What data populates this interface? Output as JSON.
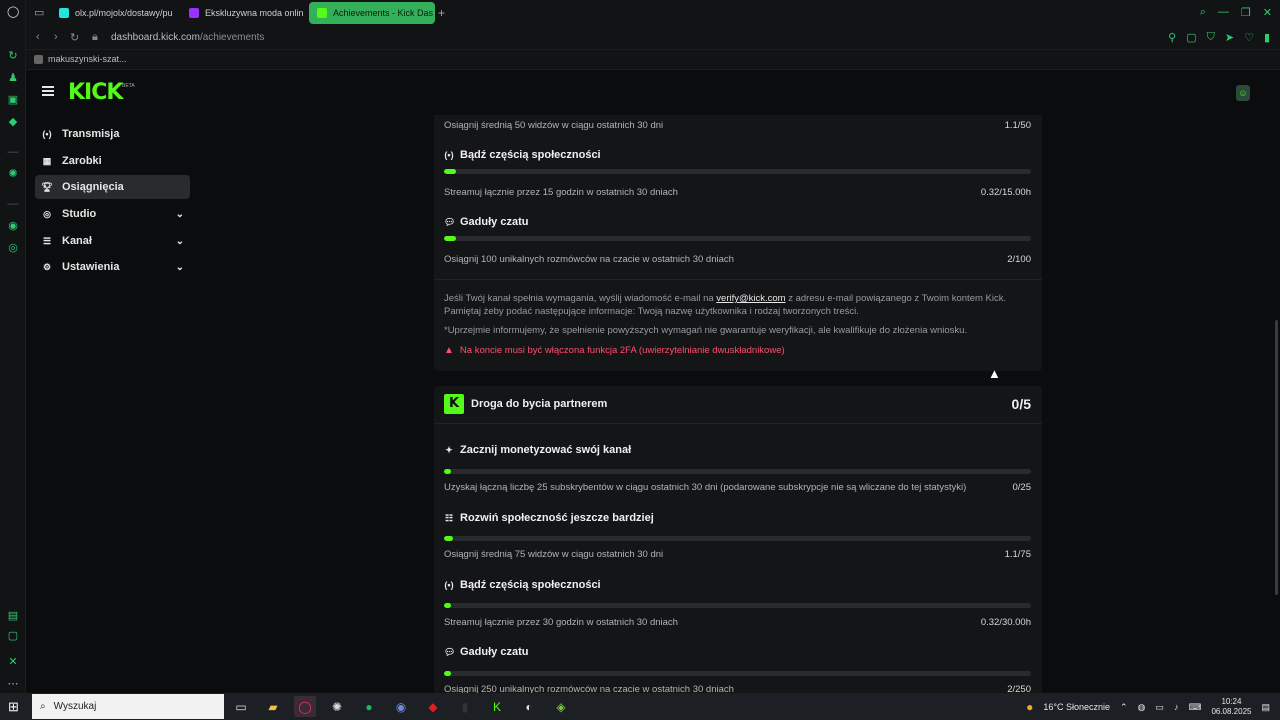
{
  "browser": {
    "tabs": [
      {
        "label": "olx.pl/mojolx/dostawy/pu",
        "favicon_color": "#23e5db"
      },
      {
        "label": "Ekskluzywna moda onlin",
        "favicon_color": "#9b30ff"
      },
      {
        "label": "Achievements - Kick Das",
        "favicon_color": "#53fc18"
      }
    ],
    "new_tab": "+",
    "url_host": "dashboard.kick.com",
    "url_path": "/achievements",
    "bookmark": "makuszynski-szat..."
  },
  "header": {
    "logo": "KICK",
    "logo_tag": "BETA"
  },
  "sidebar": {
    "items": [
      {
        "label": "Transmisja",
        "icon": "broadcast-icon"
      },
      {
        "label": "Zarobki",
        "icon": "earnings-icon"
      },
      {
        "label": "Osiągnięcia",
        "icon": "trophy-icon",
        "active": true
      },
      {
        "label": "Studio",
        "icon": "studio-icon",
        "expandable": true
      },
      {
        "label": "Kanał",
        "icon": "channel-icon",
        "expandable": true
      },
      {
        "label": "Ustawienia",
        "icon": "gear-icon",
        "expandable": true
      }
    ]
  },
  "verification": {
    "top_row": {
      "desc": "Osiągnij średnią 50 widzów w ciągu ostatnich 30 dni",
      "value": "1.1/50"
    },
    "stats": [
      {
        "title": "Bądź częścią społeczności",
        "desc": "Streamuj łącznie przez 15 godzin w ostatnich 30 dniach",
        "value": "0.32/15.00h",
        "progress": 0.021
      },
      {
        "title": "Gaduły czatu",
        "desc": "Osiągnij 100 unikalnych rozmówców na czacie w ostatnich 30 dniach",
        "value": "2/100",
        "progress": 0.02
      }
    ],
    "note_part1": "Jeśli Twój kanał spełnia wymagania, wyślij wiadomość e-mail na",
    "note_email": "verify@kick.com",
    "note_part2": "z adresu e-mail powiązanego z Twoim kontem Kick. Pamiętaj żeby podać następujące informacje: Twoją nazwę użytkownika i rodzaj tworzonych treści.",
    "disclaimer": "*Uprzejmie informujemy, że spełnienie powyższych wymagań nie gwarantuje weryfikacji, ale kwalifikuje do złożenia wniosku.",
    "warning": "Na koncie musi być włączona funkcja 2FA (uwierzytelnianie dwuskładnikowe)"
  },
  "partner": {
    "title": "Droga do bycia partnerem",
    "progress_label": "0/5",
    "stats": [
      {
        "title": "Zacznij monetyzować swój kanał",
        "desc": "Uzyskaj łączną liczbę 25 subskrybentów w ciągu ostatnich 30 dni (podarowane subskrypcje nie są wliczane do tej statystyki)",
        "value": "0/25",
        "progress": 0.0
      },
      {
        "title": "Rozwiń społeczność jeszcze bardziej",
        "desc": "Osiągnij średnią 75 widzów w ciągu ostatnich 30 dni",
        "value": "1.1/75",
        "progress": 0.015
      },
      {
        "title": "Bądź częścią społeczności",
        "desc": "Streamuj łącznie przez 30 godzin w ostatnich 30 dniach",
        "value": "0.32/30.00h",
        "progress": 0.011
      },
      {
        "title": "Gaduły czatu",
        "desc": "Osiągnij 250 unikalnych rozmówców na czacie w ostatnich 30 dniach",
        "value": "2/250",
        "progress": 0.008
      }
    ]
  },
  "taskbar": {
    "search_placeholder": "Wyszukaj",
    "weather": "16°C Słonecznie",
    "time": "10:24",
    "date": "06.08.2025"
  },
  "colors": {
    "accent": "#53fc18",
    "warning": "#ff4d6d",
    "active_tab": "#35b05a"
  }
}
